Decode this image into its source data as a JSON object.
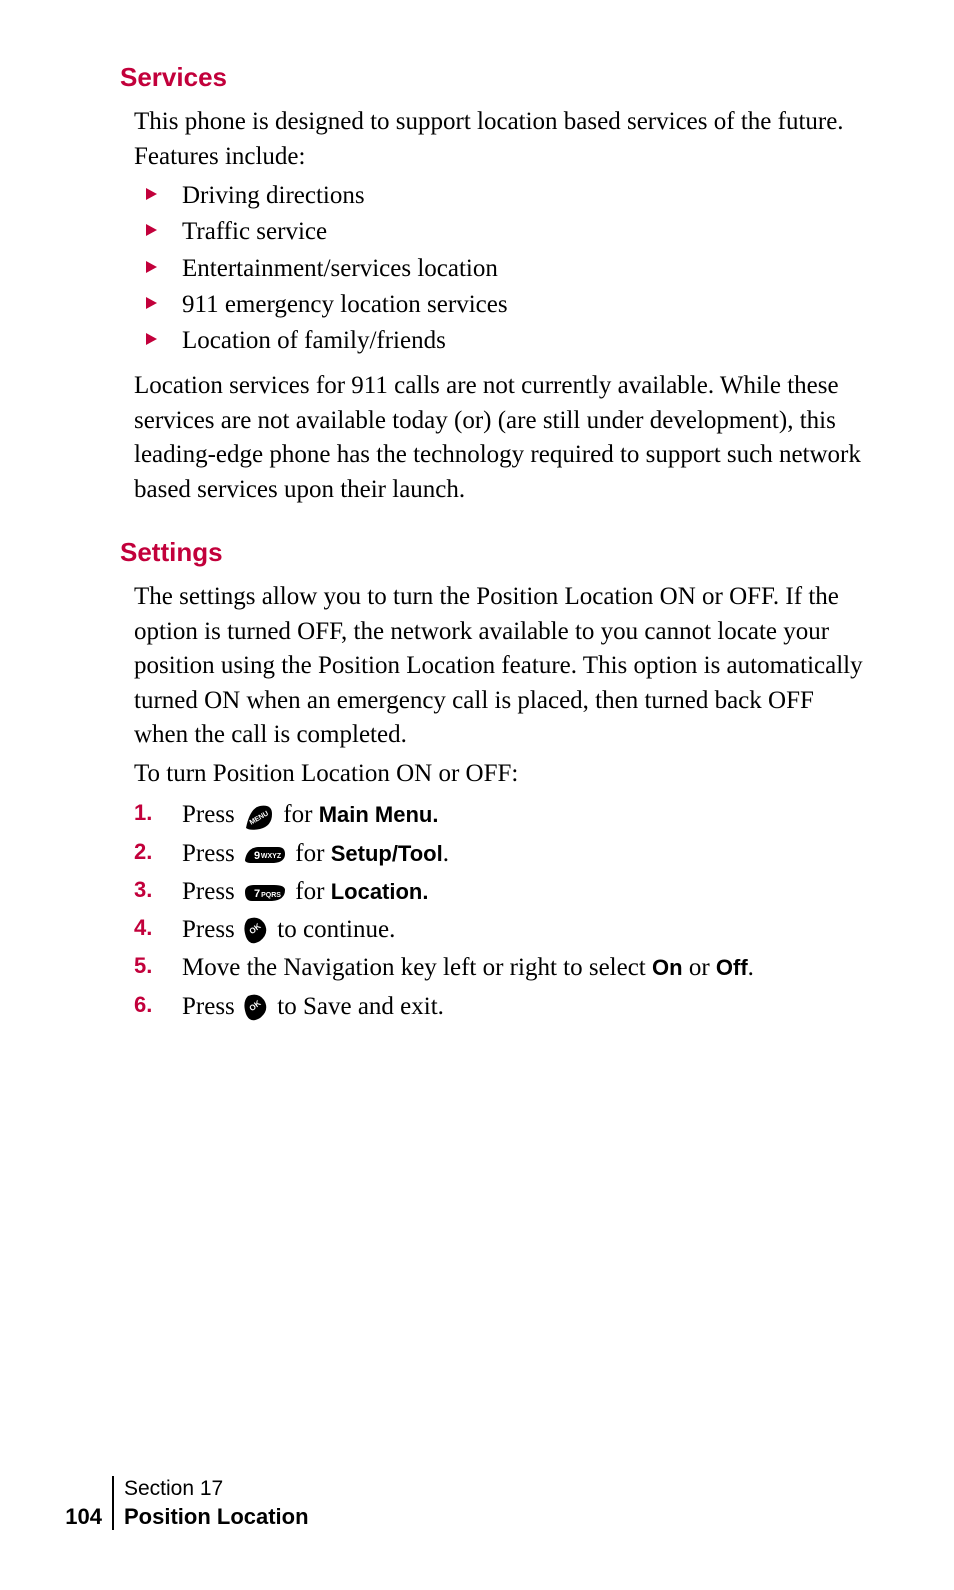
{
  "services": {
    "heading": "Services",
    "intro": "This phone is designed to support location based services of the future. Features include:",
    "bullets": [
      "Driving directions",
      "Traffic service",
      "Entertainment/services location",
      "911 emergency location services",
      "Location of family/friends"
    ],
    "outro": "Location services for 911 calls are not currently available. While these services are not available today (or) (are still under development), this leading-edge phone has the technology required to support such network based services upon their launch."
  },
  "settings": {
    "heading": "Settings",
    "intro": "The settings allow you to turn the Position Location ON or OFF. If the option is turned OFF, the network available to you cannot locate your position using the Position Location feature. This option is automatically turned ON when an emergency call is placed, then turned back OFF when the call is completed.",
    "lead_in": "To turn Position Location ON or OFF:",
    "steps": {
      "press": "Press",
      "for": "for",
      "main_menu": "Main Menu.",
      "setup_tool": "Setup/Tool",
      "location": "Location.",
      "to_continue": "to continue.",
      "nav_line_pre": "Move the Navigation key left or right to select",
      "on": "On",
      "or": "or",
      "off": "Off",
      "to_save": "to Save and exit."
    }
  },
  "keys": {
    "menu": "MENU",
    "nine": "9WXYZ",
    "seven": "7PQRS",
    "ok": "OK"
  },
  "footer": {
    "page": "104",
    "section": "Section 17",
    "title": "Position Location"
  }
}
